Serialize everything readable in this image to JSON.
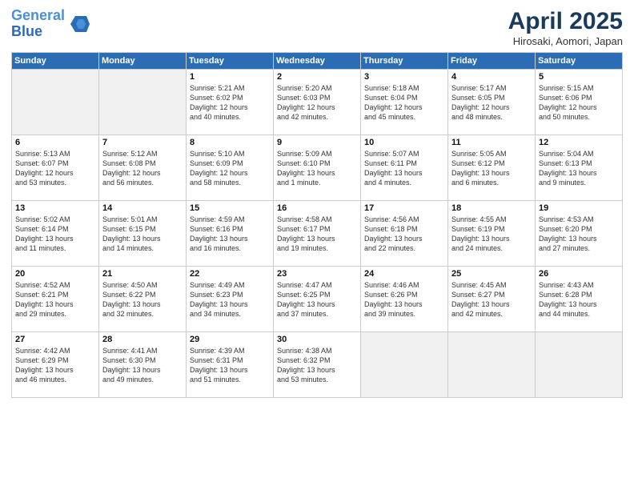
{
  "header": {
    "logo_line1": "General",
    "logo_line2": "Blue",
    "month_title": "April 2025",
    "location": "Hirosaki, Aomori, Japan"
  },
  "weekdays": [
    "Sunday",
    "Monday",
    "Tuesday",
    "Wednesday",
    "Thursday",
    "Friday",
    "Saturday"
  ],
  "weeks": [
    [
      {
        "day": "",
        "info": ""
      },
      {
        "day": "",
        "info": ""
      },
      {
        "day": "1",
        "info": "Sunrise: 5:21 AM\nSunset: 6:02 PM\nDaylight: 12 hours\nand 40 minutes."
      },
      {
        "day": "2",
        "info": "Sunrise: 5:20 AM\nSunset: 6:03 PM\nDaylight: 12 hours\nand 42 minutes."
      },
      {
        "day": "3",
        "info": "Sunrise: 5:18 AM\nSunset: 6:04 PM\nDaylight: 12 hours\nand 45 minutes."
      },
      {
        "day": "4",
        "info": "Sunrise: 5:17 AM\nSunset: 6:05 PM\nDaylight: 12 hours\nand 48 minutes."
      },
      {
        "day": "5",
        "info": "Sunrise: 5:15 AM\nSunset: 6:06 PM\nDaylight: 12 hours\nand 50 minutes."
      }
    ],
    [
      {
        "day": "6",
        "info": "Sunrise: 5:13 AM\nSunset: 6:07 PM\nDaylight: 12 hours\nand 53 minutes."
      },
      {
        "day": "7",
        "info": "Sunrise: 5:12 AM\nSunset: 6:08 PM\nDaylight: 12 hours\nand 56 minutes."
      },
      {
        "day": "8",
        "info": "Sunrise: 5:10 AM\nSunset: 6:09 PM\nDaylight: 12 hours\nand 58 minutes."
      },
      {
        "day": "9",
        "info": "Sunrise: 5:09 AM\nSunset: 6:10 PM\nDaylight: 13 hours\nand 1 minute."
      },
      {
        "day": "10",
        "info": "Sunrise: 5:07 AM\nSunset: 6:11 PM\nDaylight: 13 hours\nand 4 minutes."
      },
      {
        "day": "11",
        "info": "Sunrise: 5:05 AM\nSunset: 6:12 PM\nDaylight: 13 hours\nand 6 minutes."
      },
      {
        "day": "12",
        "info": "Sunrise: 5:04 AM\nSunset: 6:13 PM\nDaylight: 13 hours\nand 9 minutes."
      }
    ],
    [
      {
        "day": "13",
        "info": "Sunrise: 5:02 AM\nSunset: 6:14 PM\nDaylight: 13 hours\nand 11 minutes."
      },
      {
        "day": "14",
        "info": "Sunrise: 5:01 AM\nSunset: 6:15 PM\nDaylight: 13 hours\nand 14 minutes."
      },
      {
        "day": "15",
        "info": "Sunrise: 4:59 AM\nSunset: 6:16 PM\nDaylight: 13 hours\nand 16 minutes."
      },
      {
        "day": "16",
        "info": "Sunrise: 4:58 AM\nSunset: 6:17 PM\nDaylight: 13 hours\nand 19 minutes."
      },
      {
        "day": "17",
        "info": "Sunrise: 4:56 AM\nSunset: 6:18 PM\nDaylight: 13 hours\nand 22 minutes."
      },
      {
        "day": "18",
        "info": "Sunrise: 4:55 AM\nSunset: 6:19 PM\nDaylight: 13 hours\nand 24 minutes."
      },
      {
        "day": "19",
        "info": "Sunrise: 4:53 AM\nSunset: 6:20 PM\nDaylight: 13 hours\nand 27 minutes."
      }
    ],
    [
      {
        "day": "20",
        "info": "Sunrise: 4:52 AM\nSunset: 6:21 PM\nDaylight: 13 hours\nand 29 minutes."
      },
      {
        "day": "21",
        "info": "Sunrise: 4:50 AM\nSunset: 6:22 PM\nDaylight: 13 hours\nand 32 minutes."
      },
      {
        "day": "22",
        "info": "Sunrise: 4:49 AM\nSunset: 6:23 PM\nDaylight: 13 hours\nand 34 minutes."
      },
      {
        "day": "23",
        "info": "Sunrise: 4:47 AM\nSunset: 6:25 PM\nDaylight: 13 hours\nand 37 minutes."
      },
      {
        "day": "24",
        "info": "Sunrise: 4:46 AM\nSunset: 6:26 PM\nDaylight: 13 hours\nand 39 minutes."
      },
      {
        "day": "25",
        "info": "Sunrise: 4:45 AM\nSunset: 6:27 PM\nDaylight: 13 hours\nand 42 minutes."
      },
      {
        "day": "26",
        "info": "Sunrise: 4:43 AM\nSunset: 6:28 PM\nDaylight: 13 hours\nand 44 minutes."
      }
    ],
    [
      {
        "day": "27",
        "info": "Sunrise: 4:42 AM\nSunset: 6:29 PM\nDaylight: 13 hours\nand 46 minutes."
      },
      {
        "day": "28",
        "info": "Sunrise: 4:41 AM\nSunset: 6:30 PM\nDaylight: 13 hours\nand 49 minutes."
      },
      {
        "day": "29",
        "info": "Sunrise: 4:39 AM\nSunset: 6:31 PM\nDaylight: 13 hours\nand 51 minutes."
      },
      {
        "day": "30",
        "info": "Sunrise: 4:38 AM\nSunset: 6:32 PM\nDaylight: 13 hours\nand 53 minutes."
      },
      {
        "day": "",
        "info": ""
      },
      {
        "day": "",
        "info": ""
      },
      {
        "day": "",
        "info": ""
      }
    ]
  ]
}
